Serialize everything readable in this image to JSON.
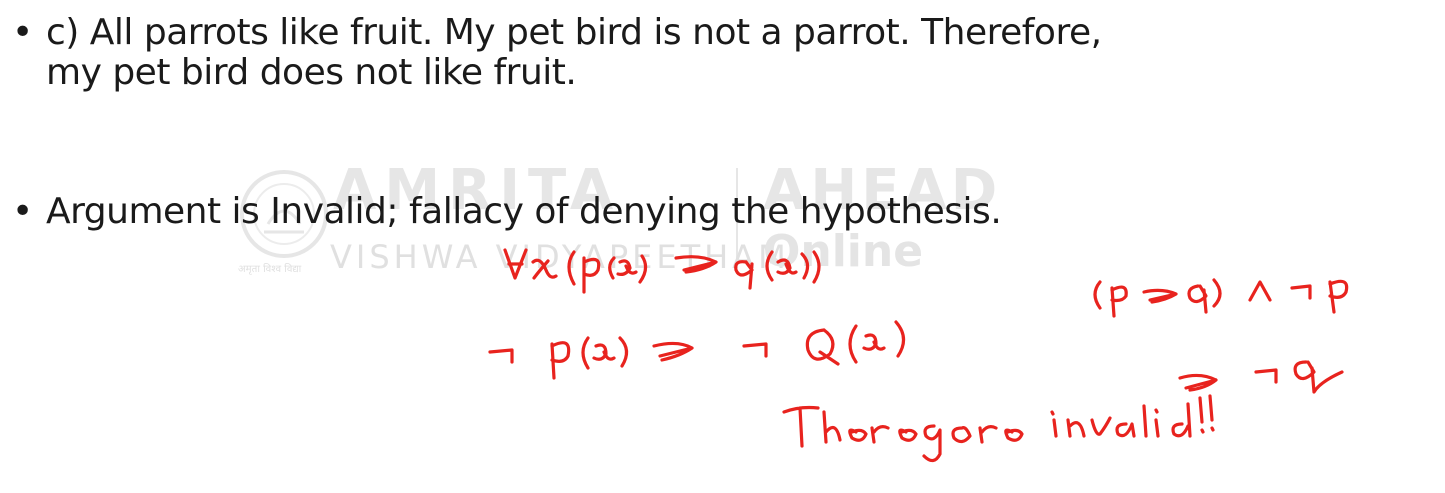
{
  "bullets": [
    {
      "marker": "•",
      "lines": [
        "c) All parrots like fruit. My pet bird is not a parrot. Therefore,",
        "my pet bird does not like fruit."
      ]
    },
    {
      "marker": "•",
      "lines": [
        "Argument is Invalid; fallacy of denying the hypothesis."
      ]
    }
  ],
  "watermark": {
    "main": "AMRITA",
    "right": "AHEAD",
    "sub": "VISHWA VIDYAPEETHAM",
    "online": "Online",
    "tiny": "अमृता विश्व विद्या"
  },
  "annotations": {
    "color": "#e8231e",
    "line1": "∀x (P(x) → Q(x))",
    "line2": "¬ P(x) → ¬ Q(x)",
    "right1": "(p → q) ∧ ¬p",
    "right2": "→ ¬q",
    "conclusion": "Therefore invalid!!"
  }
}
